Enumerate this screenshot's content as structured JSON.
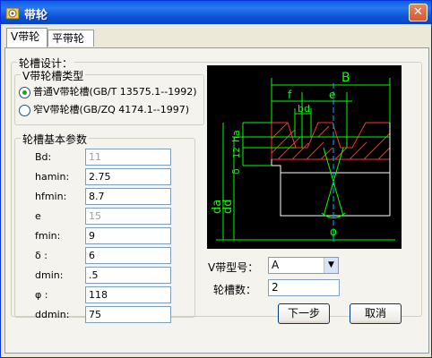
{
  "window": {
    "title": "带轮",
    "close_glyph": "✕"
  },
  "tabs": [
    {
      "label": "V带轮"
    },
    {
      "label": "平带轮"
    }
  ],
  "groove_design": {
    "title": "轮槽设计：",
    "type_group": {
      "title": "V带轮槽类型",
      "options": [
        {
          "label": "普通V带轮槽(GB/T 13575.1--1992)",
          "checked": true
        },
        {
          "label": "窄V带轮槽(GB/ZQ 4174.1--1997)",
          "checked": false
        }
      ]
    },
    "params_group": {
      "title": "轮槽基本参数",
      "params": [
        {
          "label": "Bd:",
          "value": "11",
          "disabled": true
        },
        {
          "label": "hamin:",
          "value": "2.75",
          "disabled": false
        },
        {
          "label": "hfmin:",
          "value": "8.7",
          "disabled": false
        },
        {
          "label": "e",
          "value": "15",
          "disabled": true
        },
        {
          "label": "fmin:",
          "value": "9",
          "disabled": false
        },
        {
          "label": "δ :",
          "value": "6",
          "disabled": false
        },
        {
          "label": "dmin:",
          "value": ".5",
          "disabled": false
        },
        {
          "label": "φ :",
          "value": "118",
          "disabled": false
        },
        {
          "label": "ddmin:",
          "value": "75",
          "disabled": false
        }
      ]
    }
  },
  "diagram": {
    "labels": {
      "B": "B",
      "f": "f",
      "e": "e",
      "bd": "bd",
      "ha": "ha",
      "h12": "12",
      "delta": "δ",
      "da": "da",
      "dd": "dd",
      "phi": "φ"
    },
    "colors": {
      "background": "#000000",
      "dimension": "#00ff00",
      "outline": "#ffffff",
      "hatch": "#ff3030",
      "center": "#00b0ff"
    }
  },
  "belt_type": {
    "label": "V带型号：",
    "value": "A"
  },
  "groove_count": {
    "label": "轮槽数：",
    "value": "2"
  },
  "buttons": {
    "next": "下一步",
    "cancel": "取消"
  }
}
